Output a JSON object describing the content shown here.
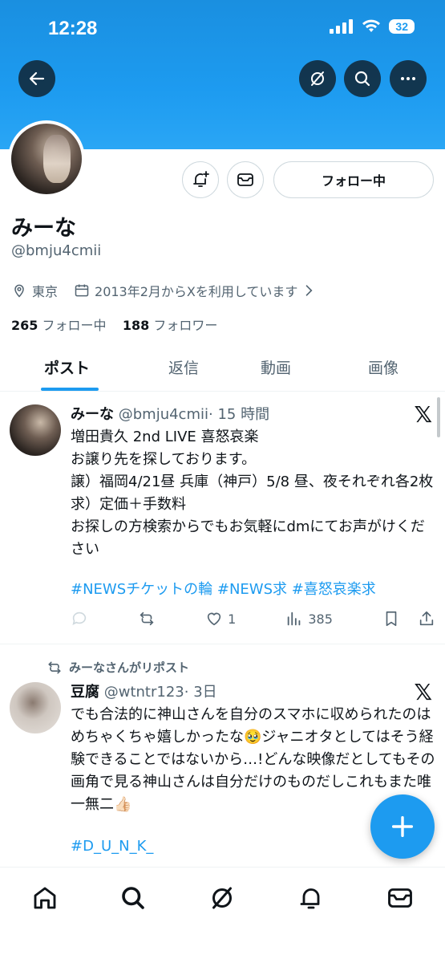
{
  "status_bar": {
    "time": "12:28",
    "battery": "32"
  },
  "profile": {
    "display_name": "みーな",
    "handle": "@bmju4cmii",
    "location": "東京",
    "joined": "2013年2月からXを利用しています",
    "following_count": "265",
    "following_label": "フォロー中",
    "followers_count": "188",
    "followers_label": "フォロワー",
    "follow_button_label": "フォロー中"
  },
  "tabs": [
    {
      "label": "ポスト",
      "active": true
    },
    {
      "label": "返信",
      "active": false
    },
    {
      "label": "動画",
      "active": false
    },
    {
      "label": "画像",
      "active": false
    }
  ],
  "posts": [
    {
      "name": "みーな",
      "handle": "@bmju4cmii",
      "time": "· 15 時間",
      "text": "増田貴久 2nd LIVE 喜怒哀楽\nお譲り先を探しております。\n譲）福岡4/21昼 兵庫（神戸）5/8 昼、夜それぞれ各2枚\n求）定価＋手数料\nお探しの方検索からでもお気軽にdmにてお声がけください",
      "hashtags": "#NEWSチケットの輪 #NEWS求 #喜怒哀楽求",
      "likes": "1",
      "views": "385"
    },
    {
      "repost_label": "みーなさんがリポスト",
      "name": "豆腐",
      "handle": "@wtntr123",
      "time": "· 3日",
      "text": "でも合法的に神山さんを自分のスマホに収められたのはめちゃくちゃ嬉しかったな🥹ジャニオタとしてはそう経験できることではないから…!どんな映像だとしてもその画角で見る神山さんは自分だけのものだしこれもまた唯一無二👍🏻",
      "hashtags": "#D_U_N_K_"
    }
  ],
  "colors": {
    "accent": "#1d9bf0",
    "text": "#0f1419",
    "muted": "#536471"
  },
  "icons": [
    "back-arrow-icon",
    "grok-icon",
    "search-icon",
    "more-icon",
    "notification-plus-icon",
    "message-icon",
    "location-icon",
    "calendar-icon",
    "chevron-right-icon",
    "reply-icon",
    "repost-icon",
    "like-icon",
    "views-icon",
    "bookmark-icon",
    "share-icon",
    "x-logo-icon",
    "compose-plus-icon",
    "home-icon",
    "notifications-icon",
    "messages-icon"
  ]
}
